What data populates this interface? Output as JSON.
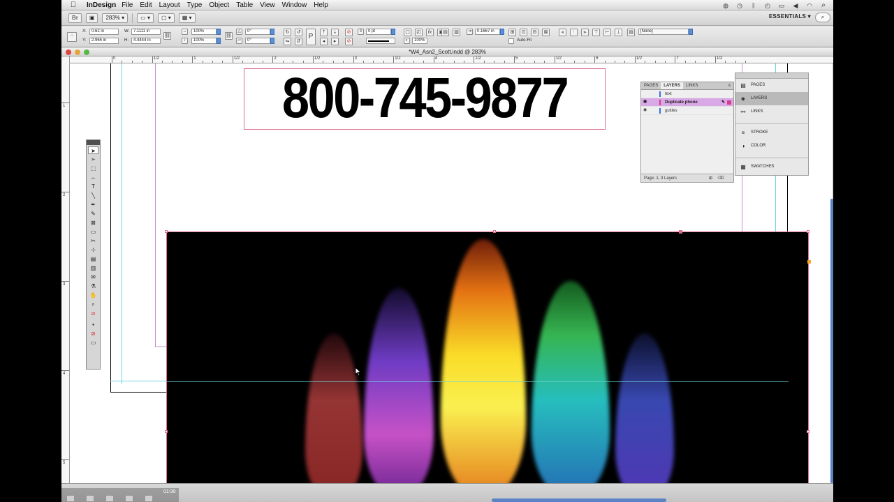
{
  "menubar": {
    "app_name": "InDesign",
    "items": [
      "File",
      "Edit",
      "Layout",
      "Type",
      "Object",
      "Table",
      "View",
      "Window",
      "Help"
    ]
  },
  "appbar": {
    "zoom": "283%",
    "workspace": "ESSENTIALS ▾"
  },
  "control": {
    "x_label": "X:",
    "x_value": "0.62 in",
    "y_label": "Y:",
    "y_value": "2.965 in",
    "w_label": "W:",
    "w_value": "7.1111 in",
    "h_label": "H:",
    "h_value": "4.4444 in",
    "scale_x": "100%",
    "scale_y": "100%",
    "rotate": "0°",
    "shear": "0°",
    "stroke_weight": "0 pt",
    "opacity": "100%",
    "offset": "0.1667 in",
    "auto_fit": "Auto-Fit",
    "object_style": "[None]"
  },
  "document": {
    "title": "*W4_Asn2_Scott.indd @ 283%",
    "phone_number": "800-745-9877"
  },
  "ruler": {
    "h_labels": [
      "0",
      "1/2",
      "1",
      "1/2",
      "2",
      "1/2",
      "3",
      "1/2",
      "4",
      "1/2",
      "5",
      "1/2",
      "6",
      "1/2",
      "7",
      "1/2"
    ],
    "v_labels": [
      "1",
      "2",
      "3",
      "4",
      "5"
    ]
  },
  "layers_panel": {
    "tabs": [
      "PAGES",
      "LAYERS",
      "LINKS"
    ],
    "layers": [
      {
        "name": "text",
        "color": "#3b6fd9",
        "selected": false
      },
      {
        "name": "Duplicate phone",
        "color": "#d83b8c",
        "selected": true
      },
      {
        "name": "guides",
        "color": "#3b6fd9",
        "selected": false
      }
    ],
    "footer": "Page: 1, 3 Layers"
  },
  "dock": {
    "items": [
      "PAGES",
      "LAYERS",
      "LINKS",
      "STROKE",
      "COLOR",
      "SWATCHES"
    ]
  },
  "video": {
    "time": "01:30"
  },
  "colors": {
    "frame_stroke": "#e06b8c",
    "guide_cyan": "#6fd6e0",
    "guide_magenta": "#c889d6",
    "selection_blue": "#5a82c5"
  }
}
